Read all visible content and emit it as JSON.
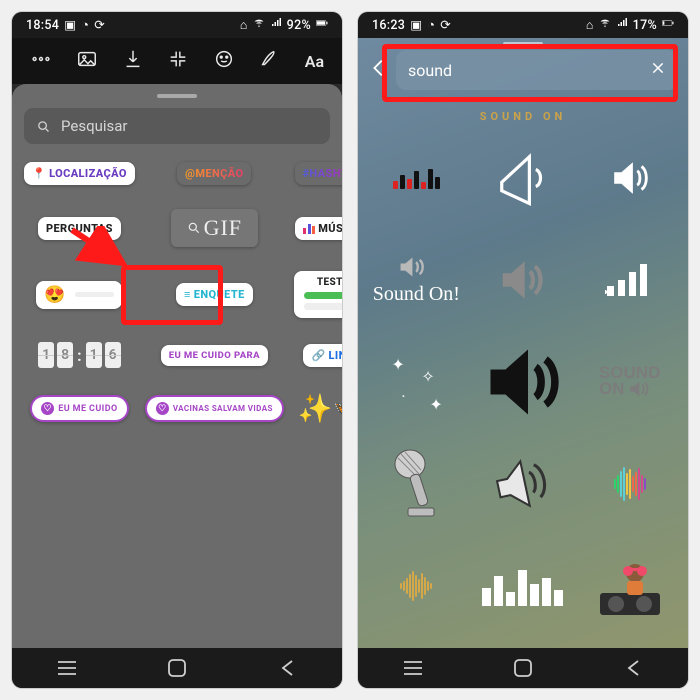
{
  "left": {
    "status": {
      "time": "18:54",
      "battery": "92%",
      "icons": [
        "image",
        "cloud",
        "rotate"
      ]
    },
    "story_tools": [
      "camera",
      "gallery",
      "save",
      "create",
      "sticker",
      "draw",
      "text"
    ],
    "search_placeholder": "Pesquisar",
    "stickers": {
      "row1": [
        {
          "id": "location",
          "label": "LOCALIZAÇÃO",
          "color": "#6a3cc0",
          "icon": "📍"
        },
        {
          "id": "mention",
          "label": "@MENÇÃO",
          "gradient": true
        },
        {
          "id": "hashtag",
          "label": "#HASHTAG",
          "gradient": true
        }
      ],
      "row2": [
        {
          "id": "questions",
          "label": "PERGUNTAS",
          "color": "#222"
        },
        {
          "id": "gif",
          "label": "GIF"
        },
        {
          "id": "music",
          "label": "MÚSICA",
          "icon": "bars"
        }
      ],
      "row3": [
        {
          "id": "emoji-slider",
          "emoji": "😍"
        },
        {
          "id": "poll",
          "label": "ENQUETE",
          "color": "#27b6cf",
          "icon": "≡"
        },
        {
          "id": "test",
          "label": "TESTE"
        }
      ],
      "row4": [
        {
          "id": "countdown",
          "digits": [
            "1",
            "8",
            "1",
            "6"
          ]
        },
        {
          "id": "eu-cuido-para",
          "label": "EU ME CUIDO PARA",
          "color": "#a646c7"
        },
        {
          "id": "link",
          "label": "LINK",
          "color": "#1f6fe0",
          "icon": "🔗"
        }
      ],
      "row5": [
        {
          "id": "eu-me-cuido",
          "label": "EU ME CUIDO"
        },
        {
          "id": "vacinas",
          "label": "VACINAS SALVAM VIDAS"
        },
        {
          "id": "sticker-graphic"
        }
      ]
    },
    "highlight_target": "gif",
    "arrow_color": "#ff1a1a"
  },
  "right": {
    "status": {
      "time": "16:23",
      "battery": "17%",
      "icons": [
        "image",
        "cloud",
        "rotate"
      ]
    },
    "search_value": "sound",
    "header_text": "SOUND ON",
    "grid": [
      [
        "eq-red",
        "megaphone-outline",
        "speaker-white"
      ],
      [
        "sound-on-script",
        "speaker-grey",
        "bars-signal"
      ],
      [
        "sparkle",
        "speaker-black-big",
        "sound-on-block"
      ],
      [
        "microphone",
        "speaker-diag",
        "rainbow-eq"
      ],
      [
        "gold-wave",
        "eq-white",
        "dj"
      ]
    ],
    "highlight_target": "search"
  },
  "nav": {
    "recent": "recent",
    "home": "home",
    "back": "back"
  }
}
